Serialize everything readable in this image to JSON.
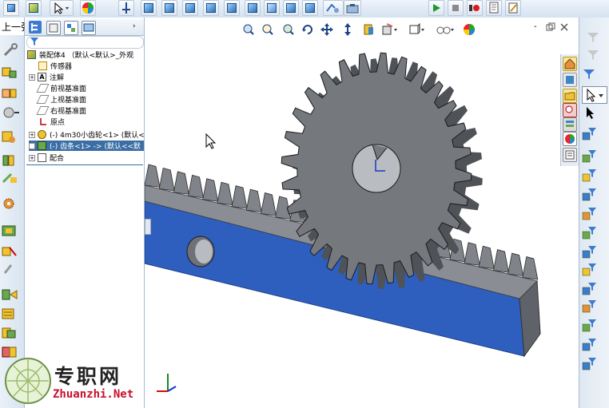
{
  "prev_label": "上一张",
  "tree": {
    "root": "装配体4 （默认<默认>_外观",
    "items": [
      {
        "label": "传感器"
      },
      {
        "label": "注解"
      },
      {
        "label": "前视基准面"
      },
      {
        "label": "上视基准面"
      },
      {
        "label": "右视基准面"
      },
      {
        "label": "原点"
      },
      {
        "label": "(-) 4m30小齿轮<1> (默认<"
      },
      {
        "label": "(-) 齿条<1> -> (默认<<默"
      },
      {
        "label": "配合"
      }
    ]
  },
  "watermark": {
    "title": "专职网",
    "url": "Zhuanzhi.Net"
  },
  "colors": {
    "gear": "#75787d",
    "rack_front": "#2f5fbe",
    "rack_teeth": "#80838a",
    "selected_row": "#3a6ea5",
    "panel_bg": "#ffffff",
    "toolbar_bg": "#dde8f4"
  }
}
